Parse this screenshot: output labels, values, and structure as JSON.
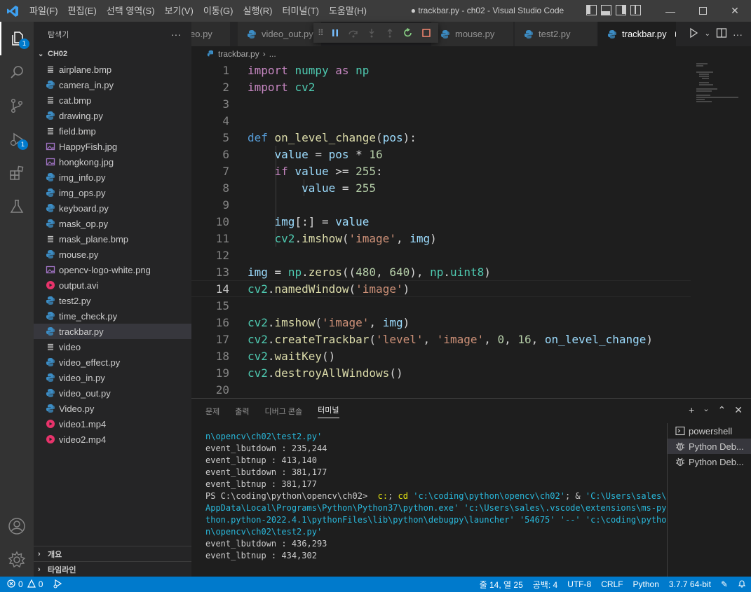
{
  "titlebar": {
    "menu": [
      "파일(F)",
      "편집(E)",
      "선택 영역(S)",
      "보기(V)",
      "이동(G)",
      "실행(R)",
      "터미널(T)",
      "도움말(H)"
    ],
    "window_title": "● trackbar.py - ch02 - Visual Studio Code"
  },
  "activity": {
    "explorer_badge": "1",
    "debug_badge": "1"
  },
  "sidebar": {
    "title": "탐색기",
    "more": "···",
    "folder": "CH02",
    "files": [
      {
        "name": "airplane.bmp",
        "type": "text"
      },
      {
        "name": "camera_in.py",
        "type": "python"
      },
      {
        "name": "cat.bmp",
        "type": "text"
      },
      {
        "name": "drawing.py",
        "type": "python"
      },
      {
        "name": "field.bmp",
        "type": "text"
      },
      {
        "name": "HappyFish.jpg",
        "type": "image"
      },
      {
        "name": "hongkong.jpg",
        "type": "image"
      },
      {
        "name": "img_info.py",
        "type": "python"
      },
      {
        "name": "img_ops.py",
        "type": "python"
      },
      {
        "name": "keyboard.py",
        "type": "python"
      },
      {
        "name": "mask_op.py",
        "type": "python"
      },
      {
        "name": "mask_plane.bmp",
        "type": "text"
      },
      {
        "name": "mouse.py",
        "type": "python"
      },
      {
        "name": "opencv-logo-white.png",
        "type": "image"
      },
      {
        "name": "output.avi",
        "type": "video"
      },
      {
        "name": "test2.py",
        "type": "python"
      },
      {
        "name": "time_check.py",
        "type": "python"
      },
      {
        "name": "trackbar.py",
        "type": "python"
      },
      {
        "name": "video",
        "type": "text"
      },
      {
        "name": "video_effect.py",
        "type": "python"
      },
      {
        "name": "video_in.py",
        "type": "python"
      },
      {
        "name": "video_out.py",
        "type": "python"
      },
      {
        "name": "Video.py",
        "type": "python"
      },
      {
        "name": "video1.mp4",
        "type": "video"
      },
      {
        "name": "video2.mp4",
        "type": "video"
      }
    ],
    "outline": "개요",
    "timeline": "타임라인"
  },
  "tabs": [
    {
      "label": "eo.py"
    },
    {
      "label": "video_out.py"
    },
    {
      "label": "mouse.py"
    },
    {
      "label": "test2.py"
    },
    {
      "label": "trackbar.py",
      "active": true,
      "dirty": true
    }
  ],
  "breadcrumb": {
    "file": "trackbar.py",
    "sep": "›",
    "rest": "..."
  },
  "editor": {
    "current_line": 14,
    "lines": [
      [
        [
          "kw",
          "import"
        ],
        [
          "t",
          " "
        ],
        [
          "mod",
          "numpy"
        ],
        [
          "t",
          " "
        ],
        [
          "kw",
          "as"
        ],
        [
          "t",
          " "
        ],
        [
          "mod",
          "np"
        ]
      ],
      [
        [
          "kw",
          "import"
        ],
        [
          "t",
          " "
        ],
        [
          "mod",
          "cv2"
        ]
      ],
      [],
      [],
      [
        [
          "kwb",
          "def"
        ],
        [
          "t",
          " "
        ],
        [
          "fn",
          "on_level_change"
        ],
        [
          "t",
          "("
        ],
        [
          "var",
          "pos"
        ],
        [
          "t",
          "):"
        ]
      ],
      [
        [
          "t",
          "    "
        ],
        [
          "var",
          "value"
        ],
        [
          "t",
          " = "
        ],
        [
          "var",
          "pos"
        ],
        [
          "t",
          " * "
        ],
        [
          "num",
          "16"
        ]
      ],
      [
        [
          "t",
          "    "
        ],
        [
          "kw",
          "if"
        ],
        [
          "t",
          " "
        ],
        [
          "var",
          "value"
        ],
        [
          "t",
          " >= "
        ],
        [
          "num",
          "255"
        ],
        [
          "t",
          ":"
        ]
      ],
      [
        [
          "t",
          "        "
        ],
        [
          "var",
          "value"
        ],
        [
          "t",
          " = "
        ],
        [
          "num",
          "255"
        ]
      ],
      [],
      [
        [
          "t",
          "    "
        ],
        [
          "var",
          "img"
        ],
        [
          "t",
          "[:] = "
        ],
        [
          "var",
          "value"
        ]
      ],
      [
        [
          "t",
          "    "
        ],
        [
          "mod",
          "cv2"
        ],
        [
          "t",
          "."
        ],
        [
          "fn",
          "imshow"
        ],
        [
          "t",
          "("
        ],
        [
          "str",
          "'image'"
        ],
        [
          "t",
          ", "
        ],
        [
          "var",
          "img"
        ],
        [
          "t",
          ")"
        ]
      ],
      [],
      [
        [
          "var",
          "img"
        ],
        [
          "t",
          " = "
        ],
        [
          "mod",
          "np"
        ],
        [
          "t",
          "."
        ],
        [
          "fn",
          "zeros"
        ],
        [
          "t",
          "(("
        ],
        [
          "num",
          "480"
        ],
        [
          "t",
          ", "
        ],
        [
          "num",
          "640"
        ],
        [
          "t",
          "), "
        ],
        [
          "mod",
          "np"
        ],
        [
          "t",
          "."
        ],
        [
          "mod",
          "uint8"
        ],
        [
          "t",
          ")"
        ]
      ],
      [
        [
          "mod",
          "cv2"
        ],
        [
          "t",
          "."
        ],
        [
          "fn",
          "namedWindow"
        ],
        [
          "t",
          "("
        ],
        [
          "str",
          "'image'"
        ],
        [
          "t",
          ")"
        ]
      ],
      [],
      [
        [
          "mod",
          "cv2"
        ],
        [
          "t",
          "."
        ],
        [
          "fn",
          "imshow"
        ],
        [
          "t",
          "("
        ],
        [
          "str",
          "'image'"
        ],
        [
          "t",
          ", "
        ],
        [
          "var",
          "img"
        ],
        [
          "t",
          ")"
        ]
      ],
      [
        [
          "mod",
          "cv2"
        ],
        [
          "t",
          "."
        ],
        [
          "fn",
          "createTrackbar"
        ],
        [
          "t",
          "("
        ],
        [
          "str",
          "'level'"
        ],
        [
          "t",
          ", "
        ],
        [
          "str",
          "'image'"
        ],
        [
          "t",
          ", "
        ],
        [
          "num",
          "0"
        ],
        [
          "t",
          ", "
        ],
        [
          "num",
          "16"
        ],
        [
          "t",
          ", "
        ],
        [
          "var",
          "on_level_change"
        ],
        [
          "t",
          ")"
        ]
      ],
      [
        [
          "mod",
          "cv2"
        ],
        [
          "t",
          "."
        ],
        [
          "fn",
          "waitKey"
        ],
        [
          "t",
          "()"
        ]
      ],
      [
        [
          "mod",
          "cv2"
        ],
        [
          "t",
          "."
        ],
        [
          "fn",
          "destroyAllWindows"
        ],
        [
          "t",
          "()"
        ]
      ],
      []
    ]
  },
  "panel": {
    "tabs": [
      {
        "label": "문제"
      },
      {
        "label": "출력"
      },
      {
        "label": "디버그 콘솔"
      },
      {
        "label": "터미널",
        "active": true
      }
    ],
    "add": "+",
    "dropdown": "⌄",
    "maximize": "⌃",
    "close": "✕",
    "terminal_lines": [
      [
        [
          "t-cyan",
          "n\\opencv\\ch02\\test2.py'"
        ]
      ],
      [
        [
          "t",
          "event_lbutdown : 235,244"
        ]
      ],
      [
        [
          "t",
          "event_lbtnup : 413,140"
        ]
      ],
      [
        [
          "t",
          "event_lbutdown : 381,177"
        ]
      ],
      [
        [
          "t",
          "event_lbtnup : 381,177"
        ]
      ],
      [
        [
          "t",
          "PS C:\\coding\\python\\opencv\\ch02>  "
        ],
        [
          "t-yellow",
          "c:"
        ],
        [
          "t",
          "; "
        ],
        [
          "t-yellow",
          "cd"
        ],
        [
          "t",
          " "
        ],
        [
          "t-cyan",
          "'c:\\coding\\python\\opencv\\ch02'"
        ],
        [
          "t",
          "; & "
        ],
        [
          "t-cyan",
          "'C:\\Users\\sales\\"
        ]
      ],
      [
        [
          "t-cyan",
          "AppData\\Local\\Programs\\Python\\Python37\\python.exe'"
        ],
        [
          "t",
          " "
        ],
        [
          "t-cyan",
          "'c:\\Users\\sales\\.vscode\\extensions\\ms-py"
        ]
      ],
      [
        [
          "t-cyan",
          "thon.python-2022.4.1\\pythonFiles\\lib\\python\\debugpy\\launcher'"
        ],
        [
          "t",
          " "
        ],
        [
          "t-cyan",
          "'54675'"
        ],
        [
          "t",
          " "
        ],
        [
          "t-cyan",
          "'--'"
        ],
        [
          "t",
          " "
        ],
        [
          "t-cyan",
          "'c:\\coding\\pytho"
        ]
      ],
      [
        [
          "t-cyan",
          "n\\opencv\\ch02\\test2.py'"
        ]
      ],
      [
        [
          "t",
          "event_lbutdown : 436,293"
        ]
      ],
      [
        [
          "t",
          "event_lbtnup : 434,302"
        ]
      ]
    ],
    "terminals": [
      {
        "label": "powershell",
        "icon": "terminal"
      },
      {
        "label": "Python Deb...",
        "icon": "bug",
        "selected": true
      },
      {
        "label": "Python Deb...",
        "icon": "bug"
      }
    ]
  },
  "status": {
    "errors": "0",
    "warnings": "0",
    "position": "줄 14, 열 25",
    "spaces": "공백: 4",
    "encoding": "UTF-8",
    "eol": "CRLF",
    "language": "Python",
    "interpreter": "3.7.7 64-bit"
  }
}
